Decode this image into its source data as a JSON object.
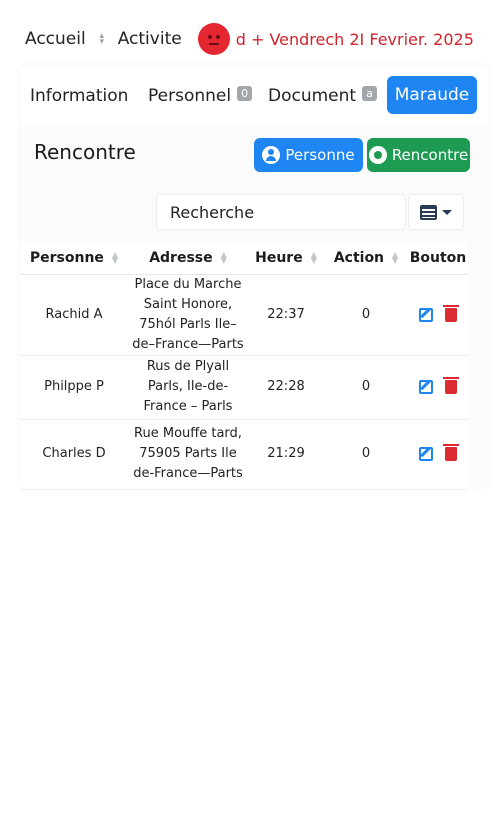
{
  "breadcrumb": {
    "home": "Accueil",
    "current": "Activite",
    "date": "d + Vendrech 2I Fevrier. 2025"
  },
  "tabs": [
    {
      "label": "Information"
    },
    {
      "label": "Personnel",
      "badge": "0"
    },
    {
      "label": "Document",
      "badge": "a"
    },
    {
      "label": "Maraude",
      "active": true
    }
  ],
  "section": {
    "title": "Rencontre",
    "btn_personne": "Personne",
    "btn_rencontre": "Rencontre"
  },
  "search": {
    "value": "Recherche"
  },
  "table": {
    "headers": [
      "Personne",
      "Adresse",
      "Heure",
      "Action",
      "Bouton"
    ],
    "rows": [
      {
        "personne": "Rachid A",
        "adresse": "Place du Marche Saint Honore, 75hól Parls Ile–de–France—Parts",
        "heure": "22:37",
        "action": "0"
      },
      {
        "personne": "Philppe P",
        "adresse": "Rus de Plyall Parls, Ile-de-France – Parls",
        "heure": "22:28",
        "action": "0"
      },
      {
        "personne": "Charles D",
        "adresse": "Rue Mouffe tard, 75905 Parts Ile de-France—Parts",
        "heure": "21:29",
        "action": "0"
      }
    ]
  },
  "colors": {
    "primary": "#1e85f3",
    "success": "#1e9b52",
    "danger": "#dc2a31",
    "date_text": "#d2232a"
  },
  "icons": [
    "breadcrumb-separator-icon",
    "status-face-icon",
    "user-icon",
    "map-pin-icon",
    "table-view-icon",
    "chevron-down-icon",
    "sort-icon",
    "edit-icon",
    "trash-icon"
  ]
}
